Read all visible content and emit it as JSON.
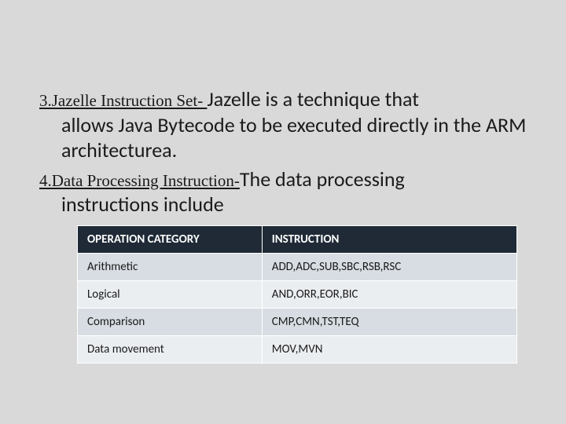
{
  "section3": {
    "lead": "3.Jazelle Instruction Set- ",
    "rest_line1": "Jazelle is a technique that",
    "rest_line2": "allows Java Bytecode to be executed directly in the ARM architecturea."
  },
  "section4": {
    "lead": "4.Data Processing Instruction-",
    "rest_line1": "The data processing",
    "rest_line2": "instructions include"
  },
  "table": {
    "headers": [
      "OPERATION CATEGORY",
      "INSTRUCTION"
    ],
    "rows": [
      [
        "Arithmetic",
        "ADD,ADC,SUB,SBC,RSB,RSC"
      ],
      [
        "Logical",
        "AND,ORR,EOR,BIC"
      ],
      [
        "Comparison",
        "CMP,CMN,TST,TEQ"
      ],
      [
        "Data movement",
        "MOV,MVN"
      ]
    ]
  }
}
